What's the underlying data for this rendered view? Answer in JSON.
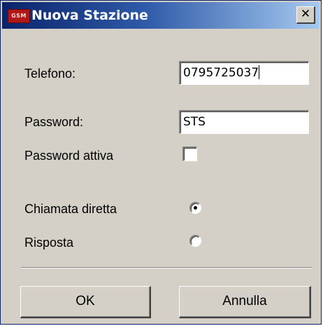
{
  "window": {
    "title": "Nuova Stazione",
    "icon_text": "GSM",
    "close_glyph": "✕"
  },
  "form": {
    "phone_label": "Telefono:",
    "phone_value": "0795725037",
    "password_label": "Password:",
    "password_value": "STS",
    "password_active_label": "Password attiva",
    "password_active_checked": false,
    "mode_options": [
      {
        "label": "Chiamata diretta",
        "selected": true
      },
      {
        "label": "Risposta",
        "selected": false
      }
    ]
  },
  "buttons": {
    "ok_label": "OK",
    "cancel_label": "Annulla"
  },
  "colors": {
    "titlebar_start": "#0a246a",
    "titlebar_end": "#a6caf0",
    "dialog_face": "#d4d0c8",
    "icon_red": "#b01818"
  }
}
